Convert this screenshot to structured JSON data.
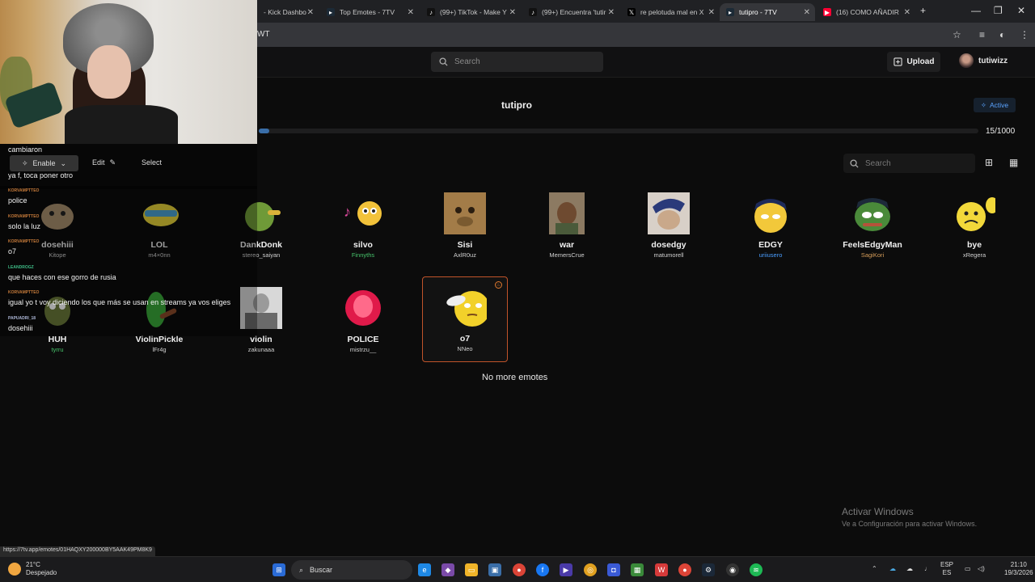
{
  "browser": {
    "tabs": [
      {
        "label": "- Kick Dashbo",
        "fav_color": "#53fc18"
      },
      {
        "label": "Top Emotes - 7TV",
        "fav_color": "#29b6f6"
      },
      {
        "label": "(99+) TikTok - Make Y",
        "fav_color": "#222"
      },
      {
        "label": "(99+) Encuentra 'tutir",
        "fav_color": "#222"
      },
      {
        "label": "re pelotuda mal en X",
        "fav_color": "#222"
      },
      {
        "label": "tutipro - 7TV",
        "fav_color": "#29b6f6"
      },
      {
        "label": "(16) COMO AÑADIR",
        "fav_color": "#ff0033"
      }
    ],
    "new_tab": "+",
    "address_fragment": "WT"
  },
  "header": {
    "search_placeholder": "Search",
    "upload_label": "Upload",
    "username": "tutiwizz"
  },
  "set": {
    "title": "tutipro",
    "status": "Active",
    "count_label": "15/1000",
    "fill_fraction": 0.015,
    "search_placeholder": "Search"
  },
  "emotes_row1": [
    {
      "name": "dosehiii",
      "owner": "Kitope",
      "owner_style": ""
    },
    {
      "name": "LOL",
      "owner": "m4×0nn",
      "owner_style": ""
    },
    {
      "name": "DankDonk",
      "owner": "stereo_saiyan",
      "owner_style": ""
    },
    {
      "name": "silvo",
      "owner": "Finnyths",
      "owner_style": "green"
    },
    {
      "name": "Sisi",
      "owner": "AxlR0uz",
      "owner_style": ""
    },
    {
      "name": "war",
      "owner": "MemersCrue",
      "owner_style": ""
    },
    {
      "name": "dosedgy",
      "owner": "matumorell",
      "owner_style": ""
    },
    {
      "name": "EDGY",
      "owner": "uriiusero",
      "owner_style": "blue"
    },
    {
      "name": "FeelsEdgyMan",
      "owner": "SagiKori",
      "owner_style": "tan"
    },
    {
      "name": "bye",
      "owner": "xRegera",
      "owner_style": ""
    }
  ],
  "emotes_row2": [
    {
      "name": "HUH",
      "owner": "tyrru",
      "owner_style": "green"
    },
    {
      "name": "ViolinPickle",
      "owner": "lFr4g",
      "owner_style": ""
    },
    {
      "name": "violin",
      "owner": "zakunaaa",
      "owner_style": ""
    },
    {
      "name": "POLICE",
      "owner": "mistrzu__",
      "owner_style": ""
    },
    {
      "name": "o7",
      "owner": "NNeo",
      "owner_style": ""
    }
  ],
  "no_more": "No more emotes",
  "overlay_toolbar": {
    "enable": "Enable",
    "edit": "Edit",
    "select": "Select"
  },
  "chat": [
    {
      "user": "",
      "text": "cambiaron"
    },
    {
      "user": "",
      "text": "ya f, toca poner otro"
    },
    {
      "user": "KORVAMPTTEO",
      "text": "police"
    },
    {
      "user": "KORVAMPTTEO",
      "text": "solo la luz"
    },
    {
      "user": "KORVAMPTTEO",
      "text": "o7"
    },
    {
      "user": "LEANDROGZ",
      "text": "que haces con ese gorro de rusia"
    },
    {
      "user": "KORVAMPTTEO",
      "text": "igual yo t voy diciendo los que más se usan en streams ya vos eliges"
    },
    {
      "user": "PAPUADRI_18",
      "text": "dosehiii"
    }
  ],
  "status_url": "https://7tv.app/emotes/01HAQXY200000BY5AAK49PM8K9",
  "watermark": {
    "line1": "Activar Windows",
    "line2": "Ve a Configuración para activar Windows."
  },
  "taskbar": {
    "temp": "21°C",
    "weather": "Despejado",
    "search": "Buscar",
    "lang_top": "ESP",
    "lang_bottom": "ES",
    "time": "21:10",
    "date": "19/3/2026"
  }
}
